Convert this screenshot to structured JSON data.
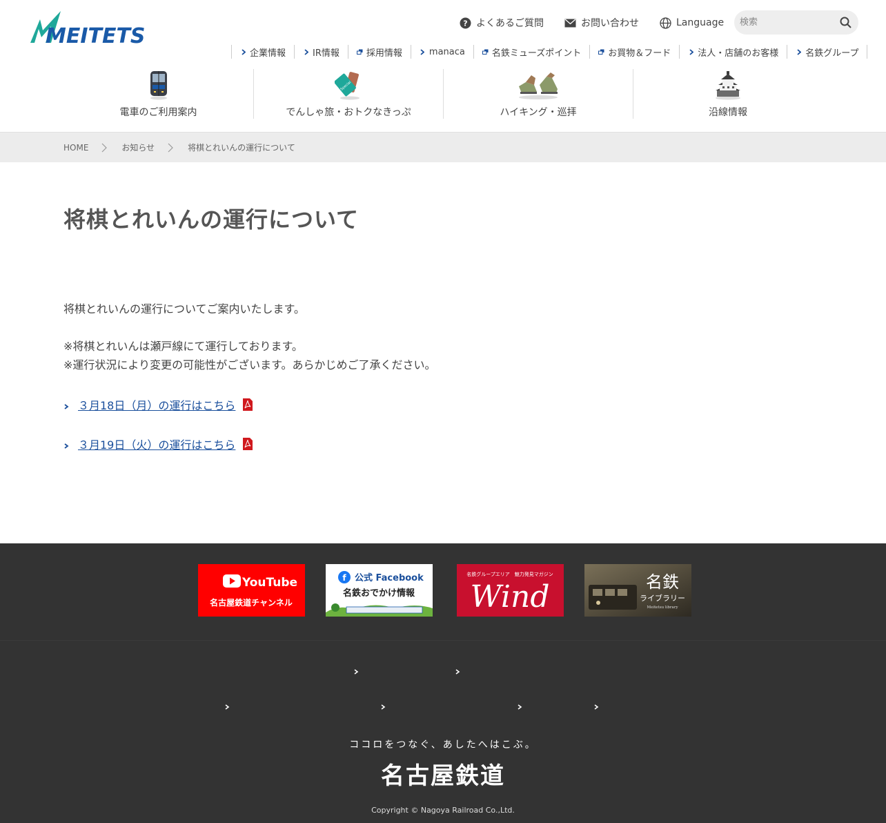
{
  "header": {
    "logo_text": "MEITETSU",
    "util": [
      {
        "label": "よくあるご質問",
        "icon": "question-circle-icon"
      },
      {
        "label": "お問い合わせ",
        "icon": "mail-icon"
      },
      {
        "label": "Language",
        "icon": "globe-icon"
      }
    ],
    "search": {
      "placeholder": "検索"
    },
    "corp_nav": [
      {
        "label": "企業情報",
        "icon": "chevron-right-icon"
      },
      {
        "label": "IR情報",
        "icon": "chevron-right-icon"
      },
      {
        "label": "採用情報",
        "icon": "external-window-icon"
      },
      {
        "label": "manaca",
        "icon": "chevron-right-icon"
      },
      {
        "label": "名鉄ミューズポイント",
        "icon": "external-window-icon"
      },
      {
        "label": "お買物＆フード",
        "icon": "external-window-icon"
      },
      {
        "label": "法人・店舗のお客様",
        "icon": "chevron-right-icon"
      },
      {
        "label": "名鉄グループ",
        "icon": "chevron-right-icon"
      }
    ],
    "main_nav": [
      {
        "label": "電車のご利用案内",
        "icon": "train-icon"
      },
      {
        "label": "でんしゃ旅・おトクなきっぷ",
        "icon": "ticket-icon"
      },
      {
        "label": "ハイキング・巡拝",
        "icon": "hiking-boots-icon"
      },
      {
        "label": "沿線情報",
        "icon": "castle-icon"
      }
    ]
  },
  "breadcrumb": {
    "home": "HOME",
    "news": "お知らせ",
    "current": "将棋とれいんの運行について"
  },
  "content": {
    "title": "将棋とれいんの運行について",
    "intro": "将棋とれいんの運行についてご案内いたします。",
    "note1": "※将棋とれいんは瀬戸線にて運行しております。",
    "note2": "※運行状況により変更の可能性がございます。あらかじめご了承ください。",
    "links": [
      {
        "label": "３月18日（月）の運行はこちら"
      },
      {
        "label": "３月19日（火）の運行はこちら"
      }
    ]
  },
  "footer": {
    "banners": {
      "youtube": {
        "logo": "YouTube",
        "sub": "名古屋鉄道チャンネル",
        "color": "#ff0000"
      },
      "facebook": {
        "top": "公式 Facebook",
        "sub": "名鉄おでかけ情報"
      },
      "wind": {
        "small": "名鉄グループエリア　魅力発見マガジン",
        "logo": "Wind",
        "color": "#c8102e"
      },
      "library": {
        "title": "名鉄",
        "sub": "ライブラリー",
        "en": "Meitetsu library"
      }
    },
    "tagline": "ココロをつなぐ、あしたへはこぶ。",
    "brand": "名古屋鉄道",
    "copyright": "Copyright © Nagoya Railroad Co.,Ltd."
  },
  "colors": {
    "brand_blue": "#1a5aa8",
    "brand_teal": "#1fa89a",
    "link": "#1a4f9c",
    "footer_bg": "#333333"
  }
}
